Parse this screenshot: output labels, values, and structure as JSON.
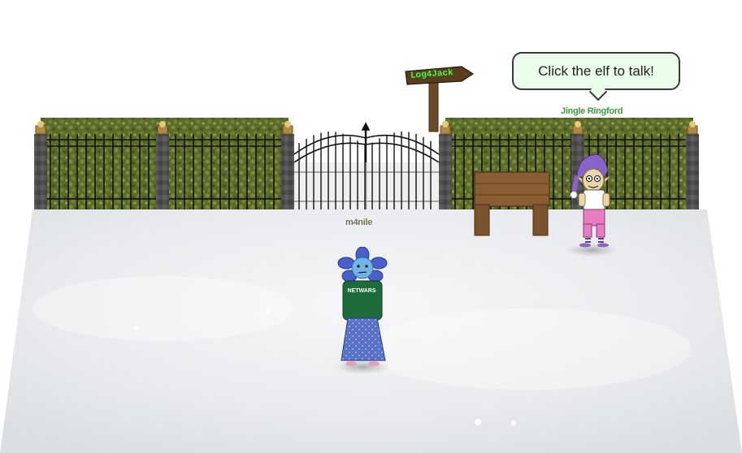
{
  "world": {
    "signpost_label": "Log4Jack",
    "npc": {
      "name": "Jingle Ringford",
      "speech": "Click the elf to talk!",
      "hat_color": "#8a63c9",
      "pants_color": "#e87cc0"
    },
    "player": {
      "name": "m4nile",
      "shirt_text": "NETWARS",
      "shirt_color": "#1f6b3c",
      "skin_color": "#6fb5e6",
      "petal_color": "#4a5fc9"
    },
    "colors": {
      "hedge": "#5c6b2a",
      "stone_pillar": "#4a4a4a",
      "snow": "#eef0f2",
      "sign_text": "#3cff3c"
    }
  }
}
